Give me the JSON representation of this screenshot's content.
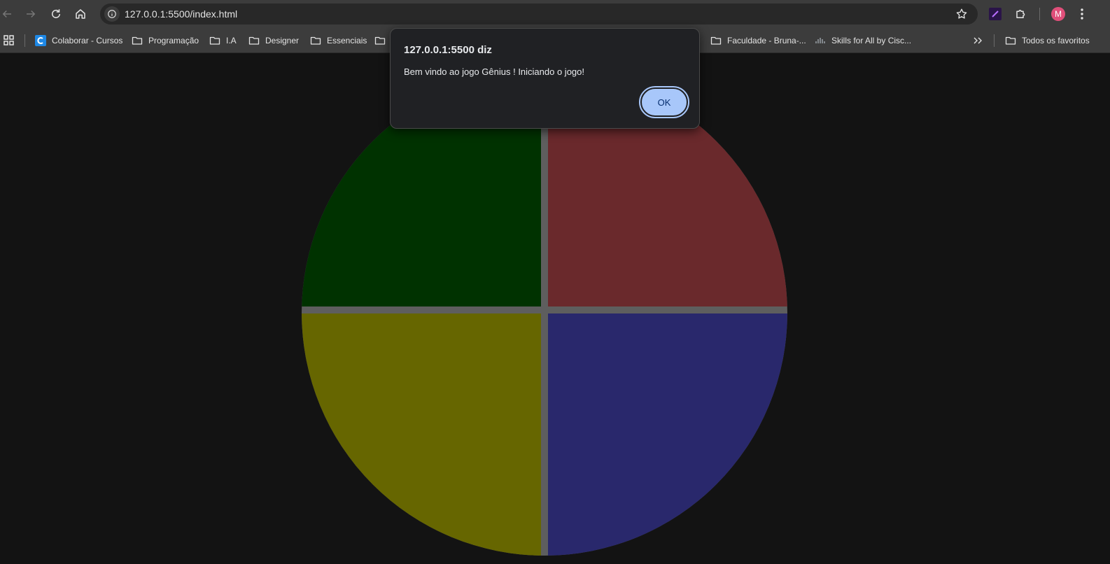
{
  "browser": {
    "url": "127.0.0.1:5500/index.html",
    "profile_initial": "M"
  },
  "bookmarks": {
    "items": [
      {
        "label": "Colaborar - Cursos",
        "icon": "colaborar-icon"
      },
      {
        "label": "Programação",
        "icon": "folder-icon"
      },
      {
        "label": "I.A",
        "icon": "folder-icon"
      },
      {
        "label": "Designer",
        "icon": "folder-icon"
      },
      {
        "label": "Essenciais",
        "icon": "folder-icon"
      },
      {
        "label": "Faculdade - Bruna-...",
        "icon": "folder-icon"
      },
      {
        "label": "Skills for All by Cisc...",
        "icon": "cisco-icon"
      }
    ],
    "all_bookmarks": "Todos os favoritos"
  },
  "dialog": {
    "title": "127.0.0.1:5500 diz",
    "message": "Bem vindo ao jogo Gênius ! Iniciando o jogo!",
    "ok_label": "OK"
  },
  "game": {
    "colors": {
      "green": "#003200",
      "red": "#6a292c",
      "yellow": "#666600",
      "blue": "#29286c",
      "divider": "#5e5e5e"
    }
  }
}
